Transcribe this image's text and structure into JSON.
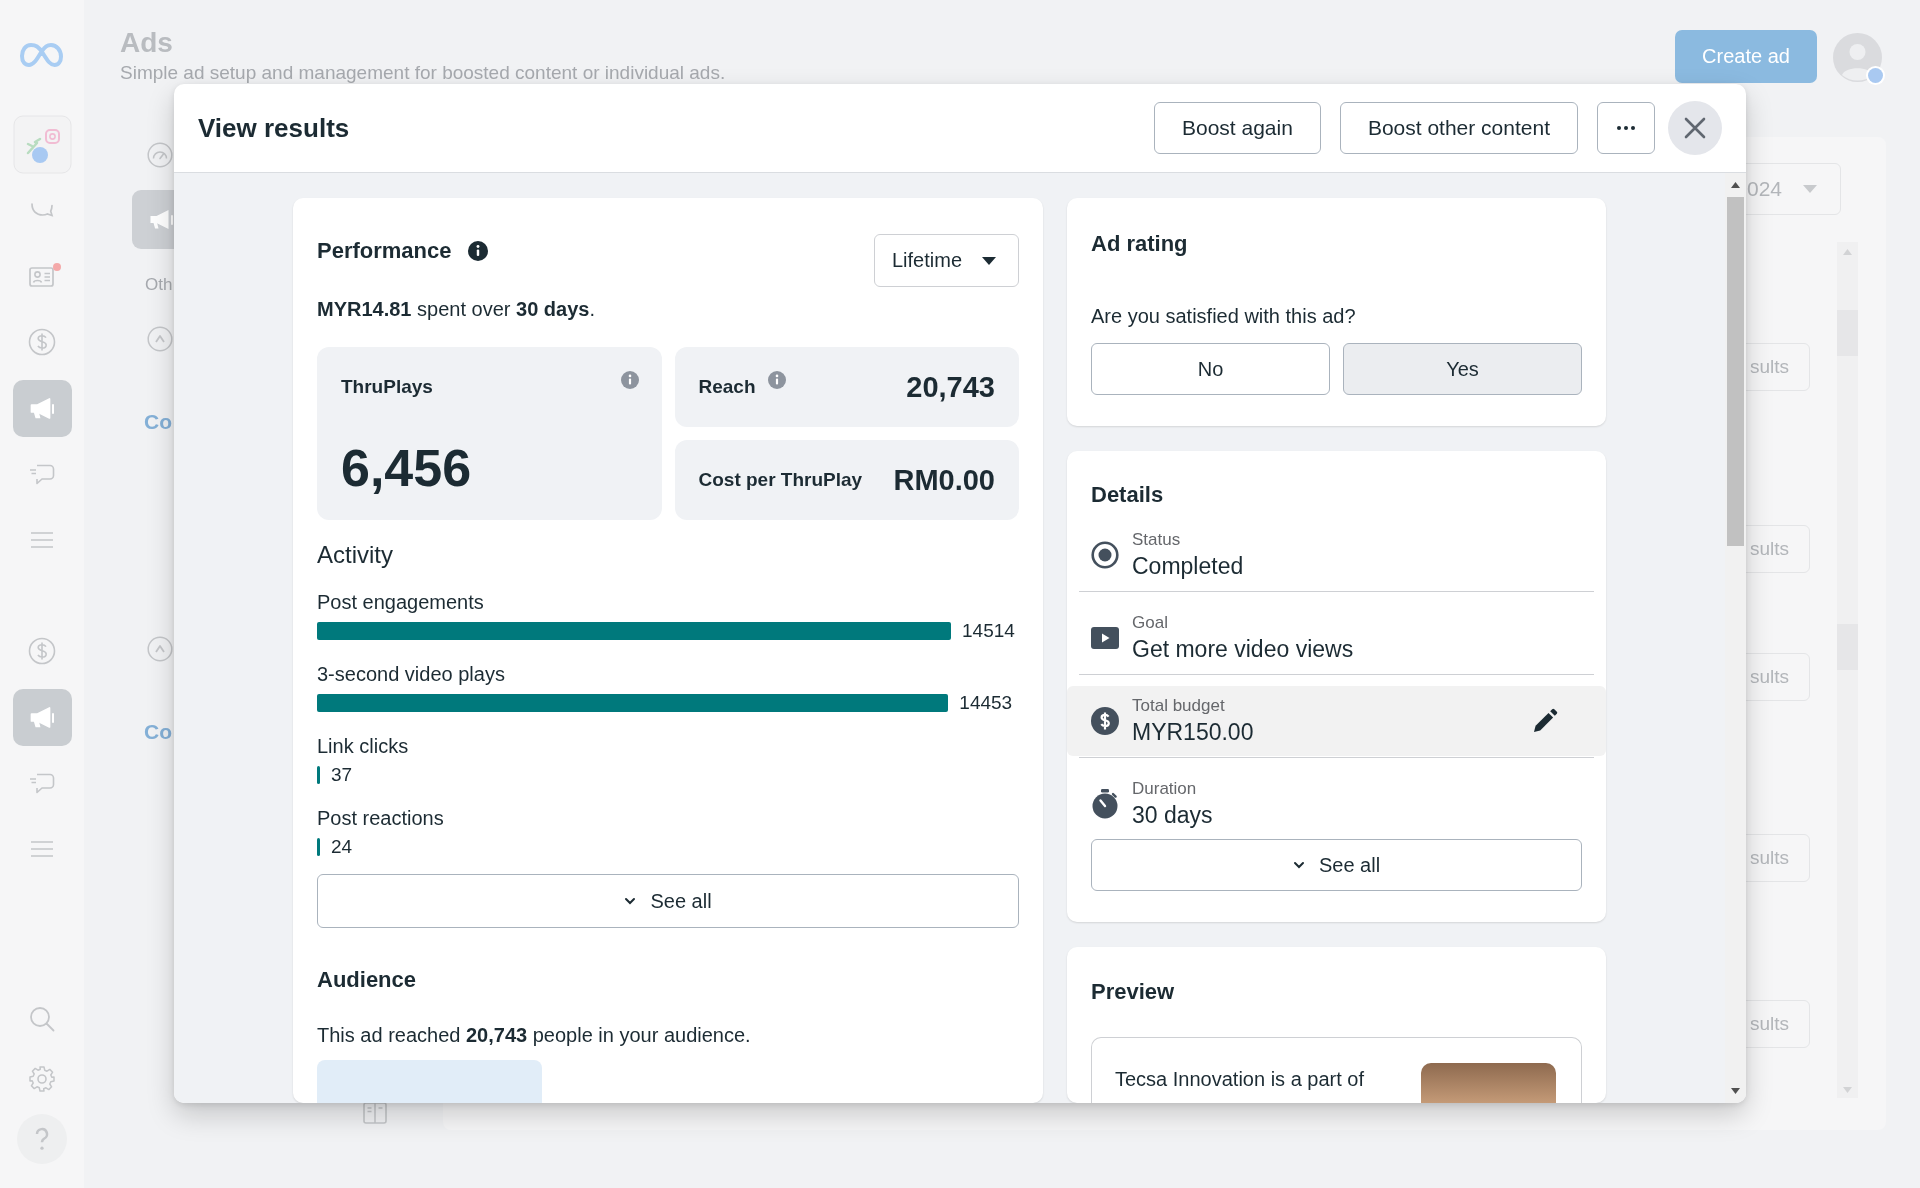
{
  "sidebar": {
    "groups": [
      {
        "items": [
          {
            "kind": "accounts",
            "selected": false,
            "notification": false
          },
          {
            "kind": "chat",
            "selected": false,
            "notification": false
          },
          {
            "kind": "contacts",
            "selected": false,
            "notification": true
          },
          {
            "kind": "billing",
            "selected": false,
            "notification": false
          },
          {
            "kind": "ads",
            "selected": true,
            "notification": false
          },
          {
            "kind": "comments",
            "selected": false,
            "notification": false
          },
          {
            "kind": "menu",
            "selected": false,
            "notification": false
          }
        ]
      },
      {
        "items": [
          {
            "kind": "billing",
            "selected": false,
            "notification": false
          },
          {
            "kind": "ads",
            "selected": true,
            "notification": false
          },
          {
            "kind": "comments",
            "selected": false,
            "notification": false
          },
          {
            "kind": "menu",
            "selected": false,
            "notification": false
          }
        ]
      }
    ],
    "footer_items": [
      {
        "kind": "search"
      },
      {
        "kind": "settings"
      },
      {
        "kind": "help"
      }
    ]
  },
  "header": {
    "title": "Ads",
    "subtitle": "Simple ad setup and management for boosted content or individual ads.",
    "create_button": "Create ad"
  },
  "campaign_list": {
    "tab": "Oth",
    "rows": [
      {
        "name": "Co"
      },
      {
        "name": "Co"
      }
    ]
  },
  "results_table": {
    "date_range": "024",
    "rows": [
      {
        "button": "sults"
      },
      {
        "button": "sults"
      },
      {
        "button": "sults"
      },
      {
        "button": "sults"
      },
      {
        "button": "sults"
      }
    ]
  },
  "dialog": {
    "title": "View results",
    "actions": [
      "Boost again",
      "Boost other content"
    ],
    "performance": {
      "title": "Performance",
      "period": "Lifetime",
      "summary": "**MYR14.81** spent over **30 days**.",
      "metrics": [
        {
          "kind": "primary",
          "label": "ThruPlays",
          "value": "6,456",
          "info": true
        },
        {
          "kind": "secondary",
          "label": "Reach",
          "value": "20,743",
          "info": true
        },
        {
          "kind": "secondary",
          "label": "Cost per ThruPlay",
          "value": "RM0.00",
          "info": false
        }
      ],
      "activity": {
        "title": "Activity",
        "items": [
          {
            "label": "Post engagements",
            "value": "14514",
            "level": 1
          },
          {
            "label": "3-second video plays",
            "value": "14453",
            "level": 0.9958
          },
          {
            "label": "Link clicks",
            "value": "37",
            "level": 0.0025
          },
          {
            "label": "Post reactions",
            "value": "24",
            "level": 0.0017
          }
        ],
        "see_all": "See all"
      },
      "audience": {
        "title": "Audience",
        "summary": "This ad reached **20,743** people in your audience."
      }
    },
    "ad_rating": {
      "title": "Ad rating",
      "question": "Are you satisfied with this ad?",
      "options": [
        {
          "label": "No",
          "selected": false
        },
        {
          "label": "Yes",
          "selected": true
        }
      ]
    },
    "details": {
      "title": "Details",
      "rows": [
        {
          "kind": "status",
          "label": "Status",
          "value": "Completed",
          "hovered": false
        },
        {
          "kind": "goal",
          "label": "Goal",
          "value": "Get more video views",
          "hovered": false
        },
        {
          "kind": "budget",
          "label": "Total budget",
          "value": "MYR150.00",
          "hovered": true
        },
        {
          "kind": "duration",
          "label": "Duration",
          "value": "30 days",
          "hovered": false
        }
      ],
      "see_all": "See all"
    },
    "preview": {
      "title": "Preview",
      "text": "Tecsa Innovation is a part of"
    }
  }
}
